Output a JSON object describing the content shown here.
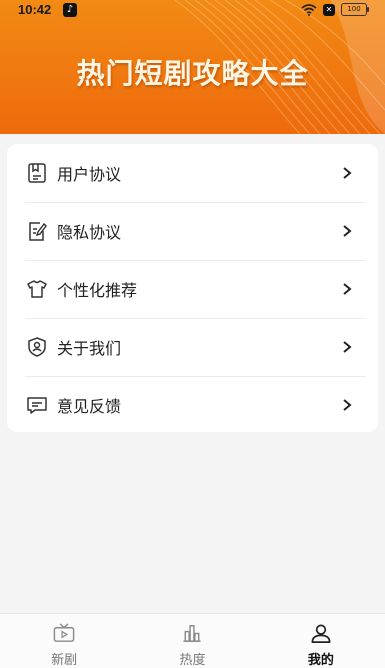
{
  "status_bar": {
    "time": "10:42",
    "battery": "100"
  },
  "header": {
    "title": "热门短剧攻略大全"
  },
  "menu": [
    {
      "label": "用户协议",
      "icon": "document-icon"
    },
    {
      "label": "隐私协议",
      "icon": "edit-document-icon"
    },
    {
      "label": "个性化推荐",
      "icon": "shirt-icon"
    },
    {
      "label": "关于我们",
      "icon": "shield-user-icon"
    },
    {
      "label": "意见反馈",
      "icon": "message-icon"
    }
  ],
  "tabs": [
    {
      "label": "新剧",
      "icon": "tv-icon",
      "active": false
    },
    {
      "label": "热度",
      "icon": "bar-chart-icon",
      "active": false
    },
    {
      "label": "我的",
      "icon": "user-icon",
      "active": true
    }
  ],
  "colors": {
    "header_top": "#f28a14",
    "header_bottom": "#ee6a0c",
    "background": "#f4f4f4"
  }
}
